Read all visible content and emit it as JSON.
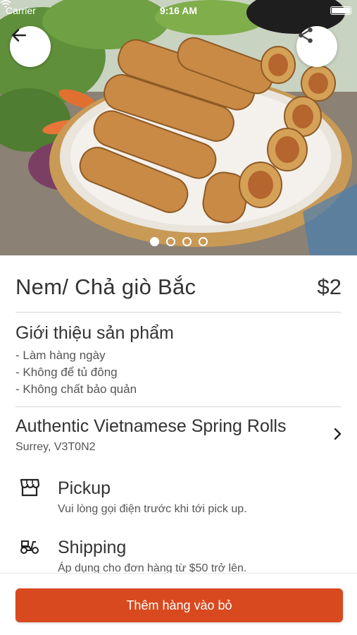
{
  "status_bar": {
    "carrier": "Carrier",
    "time": "9:16 AM"
  },
  "product": {
    "name": "Nem/ Chả giò Bắc",
    "price": "$2",
    "image_count": 4,
    "active_image_index": 0
  },
  "description": {
    "title": "Giới thiệu sản phẩm",
    "lines": [
      "- Làm hàng ngày",
      "- Không để tủ đông",
      "- Không chất bảo quản"
    ]
  },
  "store": {
    "name": "Authentic Vietnamese Spring Rolls",
    "location": "Surrey, V3T0N2"
  },
  "options": [
    {
      "icon": "storefront-icon",
      "title": "Pickup",
      "subtitle": "Vui lòng gọi điện trước khi tới pick up."
    },
    {
      "icon": "scooter-icon",
      "title": "Shipping",
      "subtitle": "Áp dụng cho đơn hàng từ $50 trở lên."
    }
  ],
  "actions": {
    "add_to_cart": "Thêm hàng vào bỏ"
  },
  "colors": {
    "accent": "#d9491f",
    "text": "#333333",
    "muted": "#555555",
    "divider": "#d6d6d6"
  }
}
